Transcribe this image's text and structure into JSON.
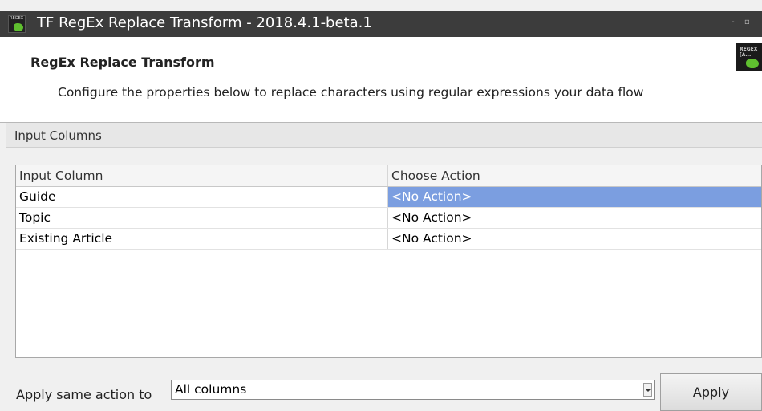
{
  "window": {
    "title": "TF RegEx Replace Transform - 2018.4.1-beta.1",
    "icon": "regex-app-icon",
    "icon_text": "REGEX",
    "minimize_glyph": "-",
    "maximize_glyph": "▫"
  },
  "header": {
    "title": "RegEx Replace Transform",
    "description": "Configure the properties below to replace characters using regular expressions your data flow",
    "logo": "regex-logo",
    "logo_text": "REGEX\n[A..."
  },
  "section": {
    "label": "Input Columns"
  },
  "grid": {
    "columns": [
      "Input Column",
      "Choose Action"
    ],
    "rows": [
      {
        "column": "Guide",
        "action": "<No Action>",
        "selected": true
      },
      {
        "column": "Topic",
        "action": "<No Action>",
        "selected": false
      },
      {
        "column": "Existing Article",
        "action": "<No Action>",
        "selected": false
      }
    ]
  },
  "footer": {
    "label": "Apply same action to",
    "select_value": "All columns",
    "apply_label": "Apply"
  },
  "colors": {
    "titlebar": "#3c3c3c",
    "selection": "#7b9ee0",
    "accent_green": "#5fbf2f"
  }
}
